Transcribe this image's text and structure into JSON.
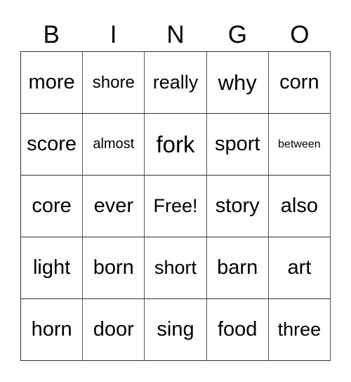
{
  "header": [
    "B",
    "I",
    "N",
    "G",
    "O"
  ],
  "rows": [
    [
      "more",
      "shore",
      "really",
      "why",
      "corn"
    ],
    [
      "score",
      "almost",
      "fork",
      "sport",
      "between"
    ],
    [
      "core",
      "ever",
      "Free!",
      "story",
      "also"
    ],
    [
      "light",
      "born",
      "short",
      "barn",
      "art"
    ],
    [
      "horn",
      "door",
      "sing",
      "food",
      "three"
    ]
  ]
}
